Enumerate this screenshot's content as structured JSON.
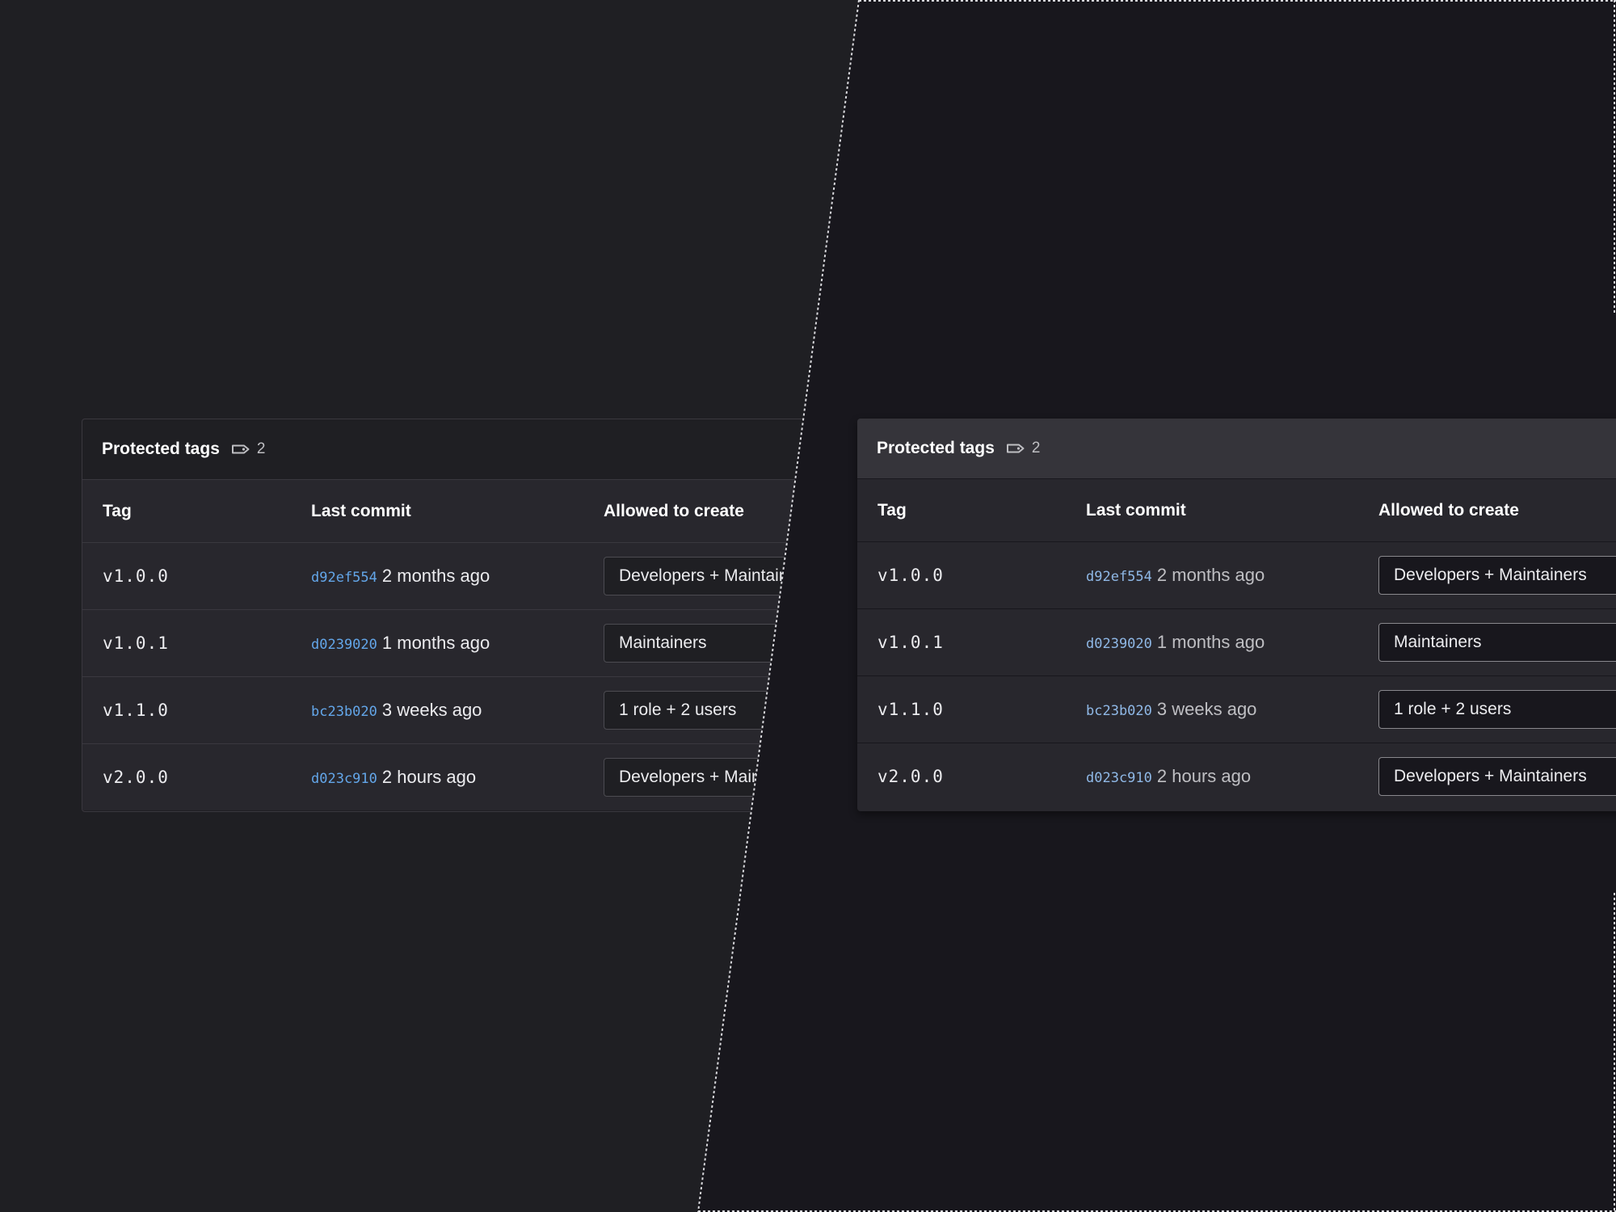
{
  "panel": {
    "title": "Protected tags",
    "tag_count": "2",
    "icon": "tag-icon",
    "columns": {
      "tag": "Tag",
      "last_commit": "Last commit",
      "allowed_to_create": "Allowed to create"
    },
    "rows": [
      {
        "tag": "v1.0.0",
        "sha": "d92ef554",
        "time": "2 months ago",
        "allowed": "Developers + Maintainers"
      },
      {
        "tag": "v1.0.1",
        "sha": "d0239020",
        "time": "1 months ago",
        "allowed": "Maintainers"
      },
      {
        "tag": "v1.1.0",
        "sha": "bc23b020",
        "time": "3 weeks ago",
        "allowed": "1 role + 2 users"
      },
      {
        "tag": "v2.0.0",
        "sha": "d023c910",
        "time": "2 hours ago",
        "allowed": "Developers + Maintainers"
      }
    ]
  },
  "colors": {
    "left_background": "#1f1f23",
    "right_background": "#18171d",
    "commit_sha_left": "#63a6e9",
    "commit_sha_right": "#8fb8e6"
  }
}
